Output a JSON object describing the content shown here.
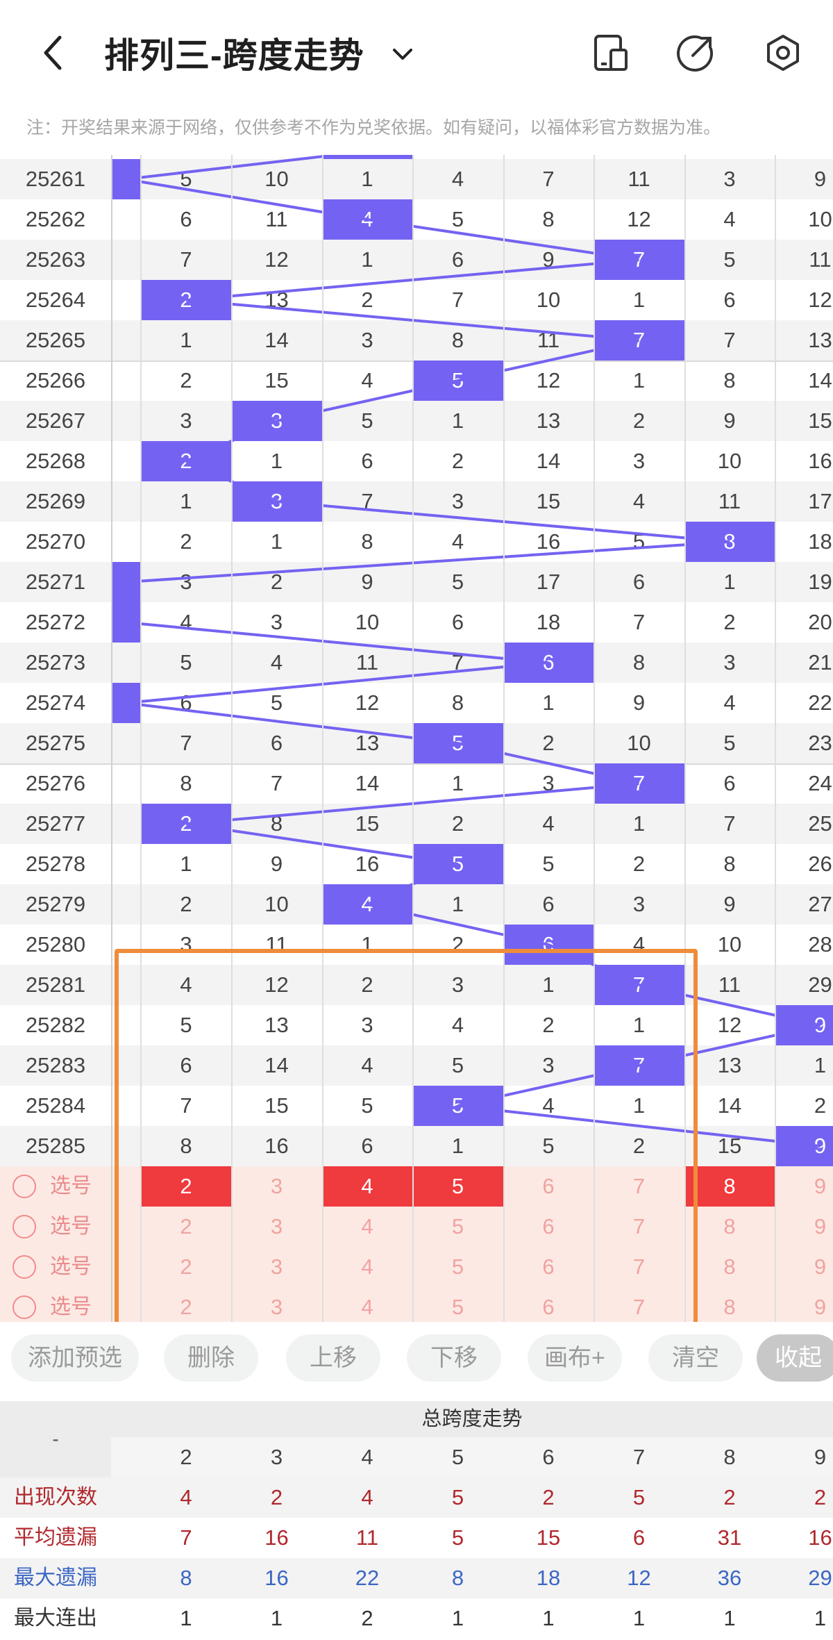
{
  "header": {
    "title": "排列三-跨度走势",
    "notice": "注：开奖结果来源于网络，仅供参考不作为兑奖依据。如有疑问，以福体彩官方数据为准。"
  },
  "icons": {
    "back": "back-arrow-icon",
    "dropdown": "chevron-down-icon",
    "device": "device-icon",
    "share": "share-icon",
    "settings": "settings-icon"
  },
  "colors": {
    "hit": "#7463f2",
    "selected": "#ef3a3e",
    "pick_bg": "#fde9e4",
    "highlight_box": "#ef8c3b",
    "stat_red": "#b0282d",
    "stat_blue": "#3b66c4"
  },
  "columns": [
    "2",
    "3",
    "4",
    "5",
    "6",
    "7",
    "8",
    "9"
  ],
  "rows": [
    {
      "issue": "25261",
      "vals": [
        "5",
        "10",
        "1",
        "4",
        "7",
        "11",
        "3",
        "9"
      ],
      "hit": -1,
      "span_col": true
    },
    {
      "issue": "25262",
      "vals": [
        "6",
        "11",
        "4",
        "5",
        "8",
        "12",
        "4",
        "10"
      ],
      "hit": 2
    },
    {
      "issue": "25263",
      "vals": [
        "7",
        "12",
        "1",
        "6",
        "9",
        "7",
        "5",
        "11"
      ],
      "hit": 5
    },
    {
      "issue": "25264",
      "vals": [
        "2",
        "13",
        "2",
        "7",
        "10",
        "1",
        "6",
        "12"
      ],
      "hit": 0
    },
    {
      "issue": "25265",
      "vals": [
        "1",
        "14",
        "3",
        "8",
        "11",
        "7",
        "7",
        "13"
      ],
      "hit": 5
    },
    {
      "issue": "25266",
      "vals": [
        "2",
        "15",
        "4",
        "5",
        "12",
        "1",
        "8",
        "14"
      ],
      "hit": 3
    },
    {
      "issue": "25267",
      "vals": [
        "3",
        "3",
        "5",
        "1",
        "13",
        "2",
        "9",
        "15"
      ],
      "hit": 1
    },
    {
      "issue": "25268",
      "vals": [
        "2",
        "1",
        "6",
        "2",
        "14",
        "3",
        "10",
        "16"
      ],
      "hit": 0
    },
    {
      "issue": "25269",
      "vals": [
        "1",
        "3",
        "7",
        "3",
        "15",
        "4",
        "11",
        "17"
      ],
      "hit": 1
    },
    {
      "issue": "25270",
      "vals": [
        "2",
        "1",
        "8",
        "4",
        "16",
        "5",
        "8",
        "18"
      ],
      "hit": 6
    },
    {
      "issue": "25271",
      "vals": [
        "3",
        "2",
        "9",
        "5",
        "17",
        "6",
        "1",
        "19"
      ],
      "hit": -1,
      "span_col": true
    },
    {
      "issue": "25272",
      "vals": [
        "4",
        "3",
        "10",
        "6",
        "18",
        "7",
        "2",
        "20"
      ],
      "hit": -1,
      "span_col": true
    },
    {
      "issue": "25273",
      "vals": [
        "5",
        "4",
        "11",
        "7",
        "6",
        "8",
        "3",
        "21"
      ],
      "hit": 4
    },
    {
      "issue": "25274",
      "vals": [
        "6",
        "5",
        "12",
        "8",
        "1",
        "9",
        "4",
        "22"
      ],
      "hit": -1,
      "span_col": true
    },
    {
      "issue": "25275",
      "vals": [
        "7",
        "6",
        "13",
        "5",
        "2",
        "10",
        "5",
        "23"
      ],
      "hit": 3
    },
    {
      "issue": "25276",
      "vals": [
        "8",
        "7",
        "14",
        "1",
        "3",
        "7",
        "6",
        "24"
      ],
      "hit": 5
    },
    {
      "issue": "25277",
      "vals": [
        "2",
        "8",
        "15",
        "2",
        "4",
        "1",
        "7",
        "25"
      ],
      "hit": 0
    },
    {
      "issue": "25278",
      "vals": [
        "1",
        "9",
        "16",
        "5",
        "5",
        "2",
        "8",
        "26"
      ],
      "hit": 3
    },
    {
      "issue": "25279",
      "vals": [
        "2",
        "10",
        "4",
        "1",
        "6",
        "3",
        "9",
        "27"
      ],
      "hit": 2
    },
    {
      "issue": "25280",
      "vals": [
        "3",
        "11",
        "1",
        "2",
        "6",
        "4",
        "10",
        "28"
      ],
      "hit": 4
    },
    {
      "issue": "25281",
      "vals": [
        "4",
        "12",
        "2",
        "3",
        "1",
        "7",
        "11",
        "29"
      ],
      "hit": 5
    },
    {
      "issue": "25282",
      "vals": [
        "5",
        "13",
        "3",
        "4",
        "2",
        "1",
        "12",
        "9"
      ],
      "hit": 7
    },
    {
      "issue": "25283",
      "vals": [
        "6",
        "14",
        "4",
        "5",
        "3",
        "7",
        "13",
        "1"
      ],
      "hit": 5
    },
    {
      "issue": "25284",
      "vals": [
        "7",
        "15",
        "5",
        "5",
        "4",
        "1",
        "14",
        "2"
      ],
      "hit": 3
    },
    {
      "issue": "25285",
      "vals": [
        "8",
        "16",
        "6",
        "1",
        "5",
        "2",
        "15",
        "9"
      ],
      "hit": 7
    }
  ],
  "pick_rows": [
    {
      "label": "选号",
      "vals": [
        "2",
        "3",
        "4",
        "5",
        "6",
        "7",
        "8",
        "9"
      ],
      "selected": [
        0,
        2,
        3,
        6
      ]
    },
    {
      "label": "选号",
      "vals": [
        "2",
        "3",
        "4",
        "5",
        "6",
        "7",
        "8",
        "9"
      ],
      "selected": []
    },
    {
      "label": "选号",
      "vals": [
        "2",
        "3",
        "4",
        "5",
        "6",
        "7",
        "8",
        "9"
      ],
      "selected": []
    },
    {
      "label": "选号",
      "vals": [
        "2",
        "3",
        "4",
        "5",
        "6",
        "7",
        "8",
        "9"
      ],
      "selected": []
    }
  ],
  "toolbar": {
    "add": "添加预选",
    "delete": "删除",
    "up": "上移",
    "down": "下移",
    "canvas": "画布+",
    "clear": "清空",
    "collapse": "收起"
  },
  "stats": {
    "corner": "-",
    "title": "总跨度走势",
    "columns": [
      "2",
      "3",
      "4",
      "5",
      "6",
      "7",
      "8",
      "9"
    ],
    "rows": [
      {
        "label": "出现次数",
        "vals": [
          "4",
          "2",
          "4",
          "5",
          "2",
          "5",
          "2",
          "2"
        ],
        "color": "red"
      },
      {
        "label": "平均遗漏",
        "vals": [
          "7",
          "16",
          "11",
          "5",
          "15",
          "6",
          "31",
          "16"
        ],
        "color": "red"
      },
      {
        "label": "最大遗漏",
        "vals": [
          "8",
          "16",
          "22",
          "8",
          "18",
          "12",
          "36",
          "29"
        ],
        "color": "blue"
      },
      {
        "label": "最大连出",
        "vals": [
          "1",
          "1",
          "2",
          "1",
          "1",
          "1",
          "1",
          "1"
        ],
        "color": "dark"
      }
    ]
  }
}
